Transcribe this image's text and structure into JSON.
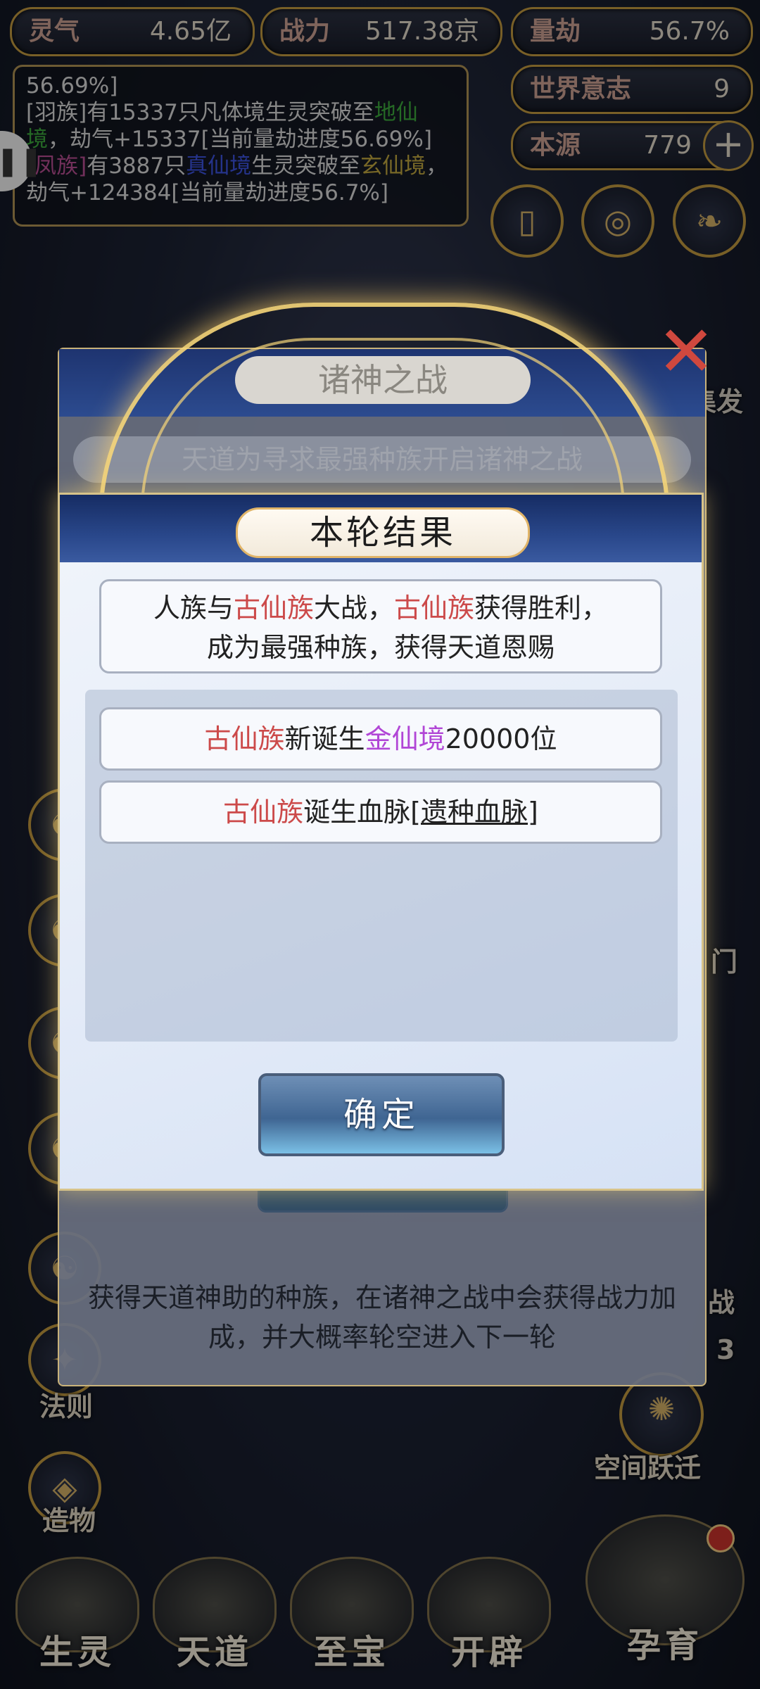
{
  "resources": {
    "lingqi": {
      "label": "灵气",
      "value": "4.65亿"
    },
    "zhanli": {
      "label": "战力",
      "value": "517.38京"
    },
    "liangjie": {
      "label": "量劫",
      "value": "56.7%"
    },
    "shijie": {
      "label": "世界意志",
      "value": "9"
    },
    "benyuan": {
      "label": "本源",
      "value": "779",
      "plus": "+"
    }
  },
  "log": {
    "line0": "56.69%]",
    "e1_a": "[羽族]有15337只凡体境生灵突破至",
    "e1_realm": "地仙境",
    "e1_b": "，劫气+15337[当前量劫进度56.69%]",
    "e2_race": "[凤族]",
    "e2_a": "有3887只",
    "e2_realm": "真仙境",
    "e2_b": "生灵突破至",
    "e2_realm2": "玄仙境",
    "e2_c": "，劫气+124384[当前量劫进度56.7%]"
  },
  "side_labels": {
    "jifa": "集发",
    "men": "门",
    "zhan": "战",
    "num3": "3",
    "faze": "法则",
    "zaowu": "造物",
    "kongjian": "空间跃迁"
  },
  "bottom_nav": [
    "生灵",
    "天道",
    "至宝",
    "开辟",
    "孕育"
  ],
  "bg_dialog": {
    "title": "诸神之战",
    "subtitle": "天道为寻求最强种族开启诸神之战",
    "description": "获得天道神助的种族，在诸神之战中会获得战力加成，并大概率轮空进入下一轮"
  },
  "dialog": {
    "title": "本轮结果",
    "summary": {
      "p1": "人族与",
      "race1": "古仙族",
      "p2": "大战，",
      "race2": "古仙族",
      "p3": "获得胜利，",
      "line2": "成为最强种族，获得天道恩赐"
    },
    "rewards": [
      {
        "race": "古仙族",
        "a": "新诞生",
        "realm": "金仙境",
        "b": "20000位"
      },
      {
        "race": "古仙族",
        "a": "诞生血脉",
        "lb": "[",
        "bloodline": "遗种血脉",
        "rb": "]"
      }
    ],
    "confirm": "确定"
  },
  "colors": {
    "race_red": "#cc4a4a",
    "realm_purple": "#b146d6",
    "gold_border": "#b8923d",
    "header_blue": "#1e3470"
  }
}
